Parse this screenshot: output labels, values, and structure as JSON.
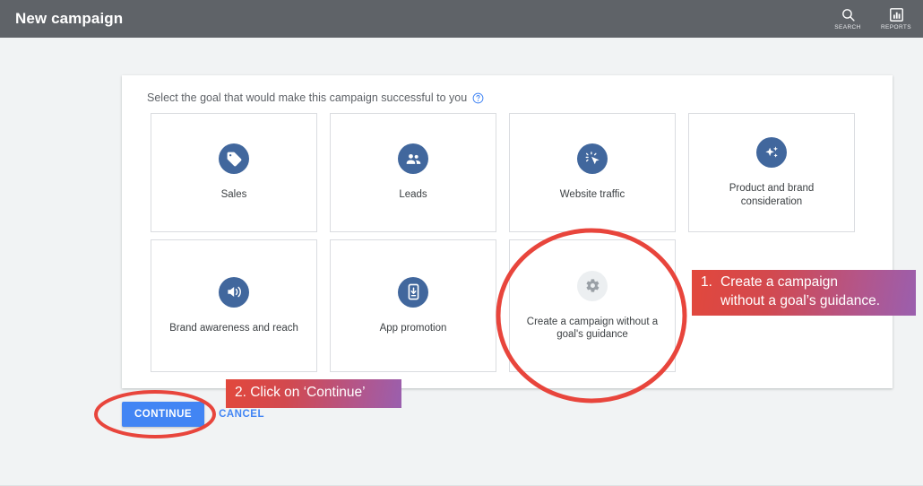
{
  "appbar": {
    "title": "New campaign",
    "actions": [
      {
        "icon": "search-icon",
        "label": "SEARCH"
      },
      {
        "icon": "reports-icon",
        "label": "REPORTS"
      }
    ],
    "background_color": "#5f6368"
  },
  "panel": {
    "prompt": "Select the goal that would make this campaign successful to you",
    "help_icon": "help-circle-icon",
    "goals": [
      {
        "label": "Sales",
        "icon": "price-tag-icon",
        "icon_style": "blue"
      },
      {
        "label": "Leads",
        "icon": "people-icon",
        "icon_style": "blue"
      },
      {
        "label": "Website traffic",
        "icon": "click-cursor-icon",
        "icon_style": "blue"
      },
      {
        "label": "Product and brand consideration",
        "icon": "sparkle-icon",
        "icon_style": "blue"
      },
      {
        "label": "Brand awareness and reach",
        "icon": "megaphone-icon",
        "icon_style": "blue"
      },
      {
        "label": "App promotion",
        "icon": "mobile-download-icon",
        "icon_style": "blue"
      },
      {
        "label": "Create a campaign without a goal's guidance",
        "icon": "gear-icon",
        "icon_style": "neutral"
      }
    ]
  },
  "footer": {
    "continue_label": "CONTINUE",
    "cancel_label": "CANCEL"
  },
  "annotations": {
    "highlight_color": "#e8453c",
    "callout_1": {
      "number": "1.",
      "line1": "Create a campaign",
      "line2": "without a goal’s guidance."
    },
    "callout_2": {
      "text": "2. Click on ‘Continue’"
    }
  },
  "colors": {
    "page_background": "#f1f3f4",
    "panel_background": "#ffffff",
    "icon_blue": "#41679d",
    "primary_button": "#4285f4",
    "link_blue": "#4285f4",
    "card_border": "#dadce0"
  }
}
